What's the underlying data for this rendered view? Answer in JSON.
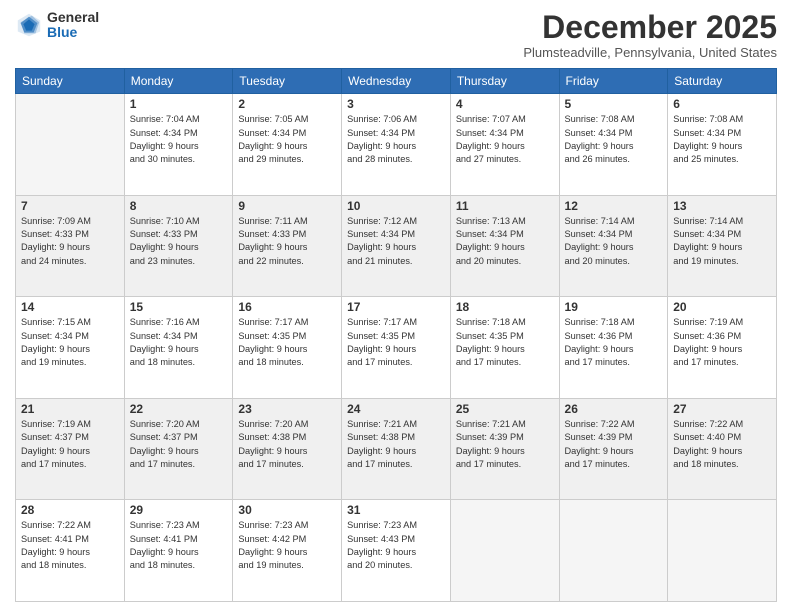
{
  "logo": {
    "general": "General",
    "blue": "Blue"
  },
  "header": {
    "month": "December 2025",
    "location": "Plumsteadville, Pennsylvania, United States"
  },
  "weekdays": [
    "Sunday",
    "Monday",
    "Tuesday",
    "Wednesday",
    "Thursday",
    "Friday",
    "Saturday"
  ],
  "weeks": [
    [
      {
        "day": "",
        "text": ""
      },
      {
        "day": "1",
        "text": "Sunrise: 7:04 AM\nSunset: 4:34 PM\nDaylight: 9 hours\nand 30 minutes."
      },
      {
        "day": "2",
        "text": "Sunrise: 7:05 AM\nSunset: 4:34 PM\nDaylight: 9 hours\nand 29 minutes."
      },
      {
        "day": "3",
        "text": "Sunrise: 7:06 AM\nSunset: 4:34 PM\nDaylight: 9 hours\nand 28 minutes."
      },
      {
        "day": "4",
        "text": "Sunrise: 7:07 AM\nSunset: 4:34 PM\nDaylight: 9 hours\nand 27 minutes."
      },
      {
        "day": "5",
        "text": "Sunrise: 7:08 AM\nSunset: 4:34 PM\nDaylight: 9 hours\nand 26 minutes."
      },
      {
        "day": "6",
        "text": "Sunrise: 7:08 AM\nSunset: 4:34 PM\nDaylight: 9 hours\nand 25 minutes."
      }
    ],
    [
      {
        "day": "7",
        "text": "Sunrise: 7:09 AM\nSunset: 4:33 PM\nDaylight: 9 hours\nand 24 minutes."
      },
      {
        "day": "8",
        "text": "Sunrise: 7:10 AM\nSunset: 4:33 PM\nDaylight: 9 hours\nand 23 minutes."
      },
      {
        "day": "9",
        "text": "Sunrise: 7:11 AM\nSunset: 4:33 PM\nDaylight: 9 hours\nand 22 minutes."
      },
      {
        "day": "10",
        "text": "Sunrise: 7:12 AM\nSunset: 4:34 PM\nDaylight: 9 hours\nand 21 minutes."
      },
      {
        "day": "11",
        "text": "Sunrise: 7:13 AM\nSunset: 4:34 PM\nDaylight: 9 hours\nand 20 minutes."
      },
      {
        "day": "12",
        "text": "Sunrise: 7:14 AM\nSunset: 4:34 PM\nDaylight: 9 hours\nand 20 minutes."
      },
      {
        "day": "13",
        "text": "Sunrise: 7:14 AM\nSunset: 4:34 PM\nDaylight: 9 hours\nand 19 minutes."
      }
    ],
    [
      {
        "day": "14",
        "text": "Sunrise: 7:15 AM\nSunset: 4:34 PM\nDaylight: 9 hours\nand 19 minutes."
      },
      {
        "day": "15",
        "text": "Sunrise: 7:16 AM\nSunset: 4:34 PM\nDaylight: 9 hours\nand 18 minutes."
      },
      {
        "day": "16",
        "text": "Sunrise: 7:17 AM\nSunset: 4:35 PM\nDaylight: 9 hours\nand 18 minutes."
      },
      {
        "day": "17",
        "text": "Sunrise: 7:17 AM\nSunset: 4:35 PM\nDaylight: 9 hours\nand 17 minutes."
      },
      {
        "day": "18",
        "text": "Sunrise: 7:18 AM\nSunset: 4:35 PM\nDaylight: 9 hours\nand 17 minutes."
      },
      {
        "day": "19",
        "text": "Sunrise: 7:18 AM\nSunset: 4:36 PM\nDaylight: 9 hours\nand 17 minutes."
      },
      {
        "day": "20",
        "text": "Sunrise: 7:19 AM\nSunset: 4:36 PM\nDaylight: 9 hours\nand 17 minutes."
      }
    ],
    [
      {
        "day": "21",
        "text": "Sunrise: 7:19 AM\nSunset: 4:37 PM\nDaylight: 9 hours\nand 17 minutes."
      },
      {
        "day": "22",
        "text": "Sunrise: 7:20 AM\nSunset: 4:37 PM\nDaylight: 9 hours\nand 17 minutes."
      },
      {
        "day": "23",
        "text": "Sunrise: 7:20 AM\nSunset: 4:38 PM\nDaylight: 9 hours\nand 17 minutes."
      },
      {
        "day": "24",
        "text": "Sunrise: 7:21 AM\nSunset: 4:38 PM\nDaylight: 9 hours\nand 17 minutes."
      },
      {
        "day": "25",
        "text": "Sunrise: 7:21 AM\nSunset: 4:39 PM\nDaylight: 9 hours\nand 17 minutes."
      },
      {
        "day": "26",
        "text": "Sunrise: 7:22 AM\nSunset: 4:39 PM\nDaylight: 9 hours\nand 17 minutes."
      },
      {
        "day": "27",
        "text": "Sunrise: 7:22 AM\nSunset: 4:40 PM\nDaylight: 9 hours\nand 18 minutes."
      }
    ],
    [
      {
        "day": "28",
        "text": "Sunrise: 7:22 AM\nSunset: 4:41 PM\nDaylight: 9 hours\nand 18 minutes."
      },
      {
        "day": "29",
        "text": "Sunrise: 7:23 AM\nSunset: 4:41 PM\nDaylight: 9 hours\nand 18 minutes."
      },
      {
        "day": "30",
        "text": "Sunrise: 7:23 AM\nSunset: 4:42 PM\nDaylight: 9 hours\nand 19 minutes."
      },
      {
        "day": "31",
        "text": "Sunrise: 7:23 AM\nSunset: 4:43 PM\nDaylight: 9 hours\nand 20 minutes."
      },
      {
        "day": "",
        "text": ""
      },
      {
        "day": "",
        "text": ""
      },
      {
        "day": "",
        "text": ""
      }
    ]
  ]
}
